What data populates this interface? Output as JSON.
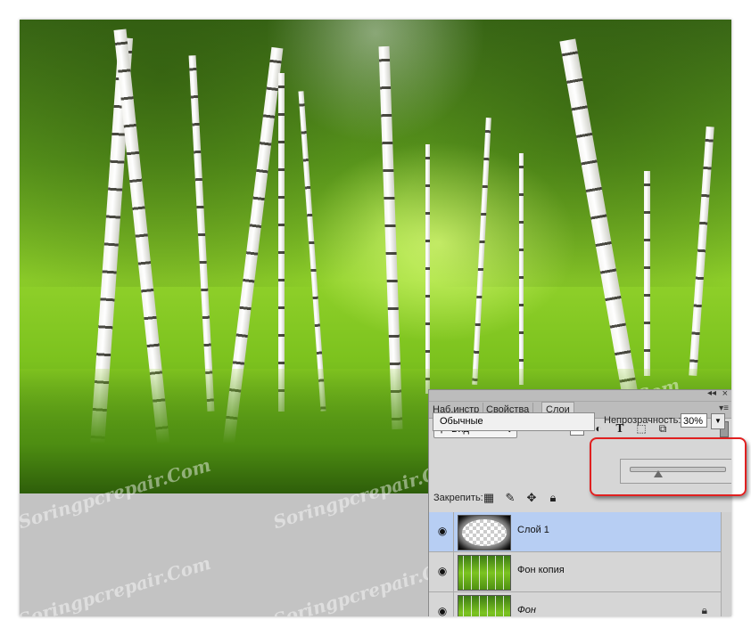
{
  "watermark": "Soringpcrepair.Com",
  "colors": {
    "highlight": "#e02020",
    "selected_layer": "#b7cef3",
    "panel_bg": "#d6d6d6"
  },
  "panel": {
    "tabs": [
      {
        "label": "Наб.инстр"
      },
      {
        "label": "Свойства"
      },
      {
        "label": "Слои",
        "active": true
      }
    ],
    "filter": {
      "kind_label": "Вид"
    },
    "blend_mode": "Обычные",
    "opacity": {
      "label": "Непрозрачность:",
      "value": "30%",
      "slider_fraction": 0.3
    },
    "lock_label": "Закрепить:",
    "layers": [
      {
        "name": "Слой 1",
        "selected": true,
        "locked": false,
        "italic": false
      },
      {
        "name": "Фон копия",
        "selected": false,
        "locked": false,
        "italic": false
      },
      {
        "name": "Фон",
        "selected": false,
        "locked": true,
        "italic": true
      }
    ]
  }
}
